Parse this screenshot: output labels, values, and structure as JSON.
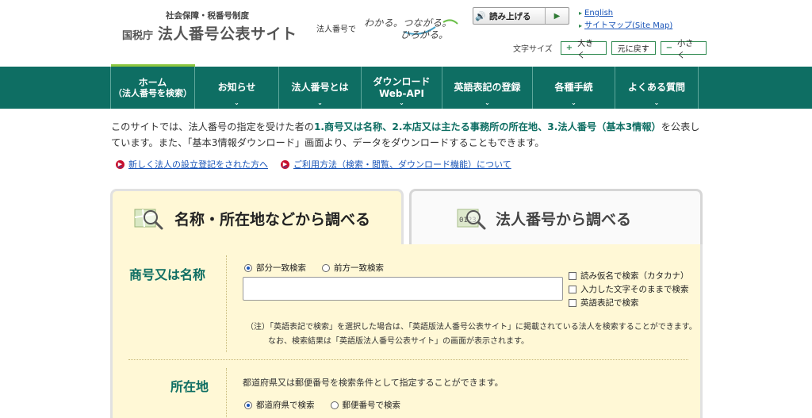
{
  "header": {
    "logo_sub": "社会保障・税番号制度",
    "logo_agency": "国税庁",
    "logo_title": "法人番号公表サイト",
    "tagline_prefix": "法人番号で",
    "tagline_words1": "わかる。つながる。",
    "tagline_words2": "ひろがる。",
    "read_aloud_label": "読み上げる",
    "links": [
      "English",
      "サイトマップ(Site Map)"
    ],
    "font_size_label": "文字サイズ",
    "font_size_buttons": [
      {
        "symbol": "+",
        "label": "大きく"
      },
      {
        "symbol": "",
        "label": "元に戻す"
      },
      {
        "symbol": "−",
        "label": "小さく"
      }
    ]
  },
  "nav": {
    "items": [
      {
        "label": "ホーム",
        "sub": "（法人番号を検索）"
      },
      {
        "label": "お知らせ",
        "sub": ""
      },
      {
        "label": "法人番号とは",
        "sub": ""
      },
      {
        "label": "ダウンロード",
        "sub": "Web-API"
      },
      {
        "label": "英語表記の登録",
        "sub": ""
      },
      {
        "label": "各種手続",
        "sub": ""
      },
      {
        "label": "よくある質問",
        "sub": ""
      }
    ]
  },
  "intro": {
    "part1": "このサイトでは、法人番号の指定を受けた者の",
    "em1": "1.商号又は名称、2.本店又は主たる事務所の所在地、3.法人番号（基本3情報）",
    "part2": "を公表しています。また、「基本3情報ダウンロード」画面より、データをダウンロードすることもできます。"
  },
  "links": [
    "新しく法人の設立登記をされた方へ",
    "ご利用方法（検索・閲覧、ダウンロード機能）について"
  ],
  "tabs": {
    "active": "名称・所在地などから調べる",
    "inactive": "法人番号から調べる",
    "inactive_icon_text": "0123"
  },
  "search": {
    "name_label": "商号又は名称",
    "radio_partial": "部分一致検索",
    "radio_prefix": "前方一致検索",
    "checks": [
      "読み仮名で検索（カタカナ）",
      "入力した文字そのままで検索",
      "英語表記で検索"
    ],
    "note_line1": "（注）「英語表記で検索」を選択した場合は、「英語版法人番号公表サイト」に掲載されている法人を検索することができます。",
    "note_line2": "なお、検索結果は「英語版法人番号公表サイト」の画面が表示されます。",
    "address_label": "所在地",
    "address_desc": "都道府県又は郵便番号を検索条件として指定することができます。",
    "radio_pref": "都道府県で検索",
    "radio_zip": "郵便番号で検索"
  }
}
